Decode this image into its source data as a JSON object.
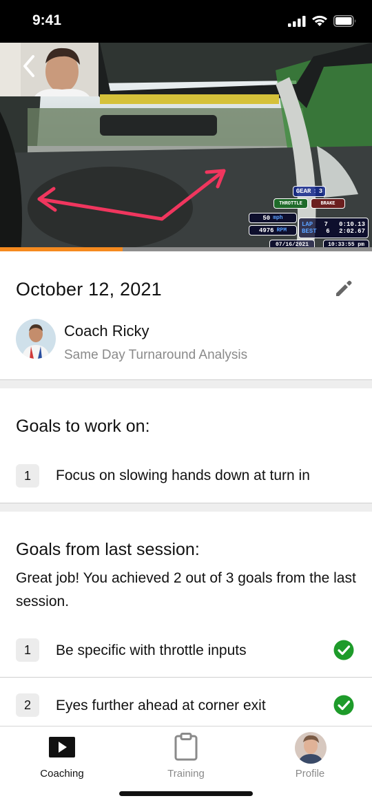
{
  "status_bar": {
    "time": "9:41"
  },
  "video": {
    "progress_fraction": 0.33,
    "telemetry": {
      "gear_label": "GEAR",
      "gear_value": "3",
      "throttle_label": "THROTTLE",
      "brake_label": "BRAKE",
      "speed_value": "50",
      "speed_unit": "mph",
      "rpm_value": "4976",
      "rpm_unit": "RPM",
      "lap_label": "LAP",
      "lap_number": "7",
      "lap_time": "0:10.13",
      "best_label": "BEST",
      "best_number": "6",
      "best_time": "2:02.67",
      "date": "07/16/2021",
      "clock": "10:33:55 pm"
    }
  },
  "session": {
    "date": "October 12, 2021",
    "coach_name": "Coach Ricky",
    "coach_subtitle": "Same Day Turnaround Analysis"
  },
  "goals": {
    "title": "Goals to work on:",
    "items": [
      {
        "number": "1",
        "text": "Focus on slowing hands down at turn in"
      }
    ]
  },
  "last_session": {
    "title": "Goals from last session:",
    "summary": "Great job! You achieved 2 out of 3 goals from the last session.",
    "items": [
      {
        "number": "1",
        "text": "Be specific with throttle inputs",
        "achieved": true
      },
      {
        "number": "2",
        "text": "Eyes further ahead at corner exit",
        "achieved": true
      }
    ]
  },
  "tab_bar": {
    "tabs": [
      {
        "label": "Coaching",
        "icon": "play-icon",
        "active": true
      },
      {
        "label": "Training",
        "icon": "clipboard-icon",
        "active": false
      },
      {
        "label": "Profile",
        "icon": "avatar",
        "active": false
      }
    ]
  },
  "colors": {
    "accent_progress": "#f58a1f",
    "check_green": "#1e9b2a",
    "annotation_arrow": "#f0365e",
    "active_tab": "#111111",
    "inactive_tab": "#8a8a8a"
  }
}
